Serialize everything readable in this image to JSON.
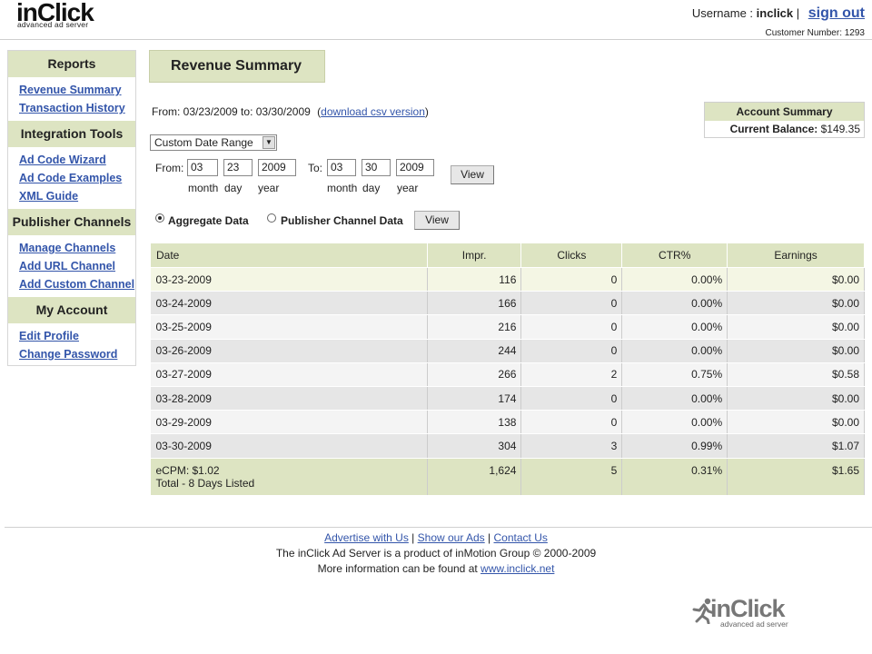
{
  "header": {
    "brand": "inClick",
    "tagline": "advanced ad server",
    "username_label": "Username :",
    "username": "inclick",
    "separator": "|",
    "signout": "sign out",
    "customer_number": "Customer Number: 1293"
  },
  "sidebar": {
    "sections": [
      {
        "title": "Reports",
        "links": [
          "Revenue Summary",
          "Transaction History"
        ]
      },
      {
        "title": "Integration Tools",
        "links": [
          "Ad Code Wizard",
          "Ad Code Examples",
          "XML Guide"
        ]
      },
      {
        "title": "Publisher Channels",
        "links": [
          "Manage Channels",
          "Add URL Channel",
          "Add Custom Channel"
        ]
      },
      {
        "title": "My Account",
        "links": [
          "Edit Profile",
          "Change Password"
        ]
      }
    ]
  },
  "main": {
    "title": "Revenue Summary",
    "date_range_text": "From: 03/23/2009 to: 03/30/2009",
    "csv_open": "(",
    "csv_link": "download csv version",
    "csv_close": ")",
    "account": {
      "title": "Account Summary",
      "balance_label": "Current Balance:",
      "balance_value": "$149.35"
    },
    "range_select": "Custom Date Range",
    "from_label": "From:",
    "to_label": "To:",
    "from": {
      "month": "03",
      "day": "23",
      "year": "2009"
    },
    "to": {
      "month": "03",
      "day": "30",
      "year": "2009"
    },
    "month_label": "month",
    "day_label": "day",
    "year_label": "year",
    "view_button": "View",
    "radio_aggregate": "Aggregate Data",
    "radio_publisher": "Publisher Channel Data",
    "view_button_2": "View"
  },
  "table": {
    "headers": {
      "date": "Date",
      "impr": "Impr.",
      "clicks": "Clicks",
      "ctr": "CTR%",
      "earnings": "Earnings"
    },
    "rows": [
      {
        "date": "03-23-2009",
        "impr": "116",
        "clicks": "0",
        "ctr": "0.00%",
        "earnings": "$0.00"
      },
      {
        "date": "03-24-2009",
        "impr": "166",
        "clicks": "0",
        "ctr": "0.00%",
        "earnings": "$0.00"
      },
      {
        "date": "03-25-2009",
        "impr": "216",
        "clicks": "0",
        "ctr": "0.00%",
        "earnings": "$0.00"
      },
      {
        "date": "03-26-2009",
        "impr": "244",
        "clicks": "0",
        "ctr": "0.00%",
        "earnings": "$0.00"
      },
      {
        "date": "03-27-2009",
        "impr": "266",
        "clicks": "2",
        "ctr": "0.75%",
        "earnings": "$0.58"
      },
      {
        "date": "03-28-2009",
        "impr": "174",
        "clicks": "0",
        "ctr": "0.00%",
        "earnings": "$0.00"
      },
      {
        "date": "03-29-2009",
        "impr": "138",
        "clicks": "0",
        "ctr": "0.00%",
        "earnings": "$0.00"
      },
      {
        "date": "03-30-2009",
        "impr": "304",
        "clicks": "3",
        "ctr": "0.99%",
        "earnings": "$1.07"
      }
    ],
    "total": {
      "ecpm": "eCPM: $1.02",
      "label": "Total - 8 Days Listed",
      "impr": "1,624",
      "clicks": "5",
      "ctr": "0.31%",
      "earnings": "$1.65"
    }
  },
  "footer": {
    "links": [
      "Advertise with Us",
      "Show our Ads",
      "Contact Us"
    ],
    "sep": "|",
    "line1": "The inClick Ad Server is a product of inMotion Group © 2000-2009",
    "line2_prefix": "More information can be found at",
    "line2_link": "www.inclick.net",
    "brand": "inClick",
    "tagline": "advanced ad server"
  }
}
